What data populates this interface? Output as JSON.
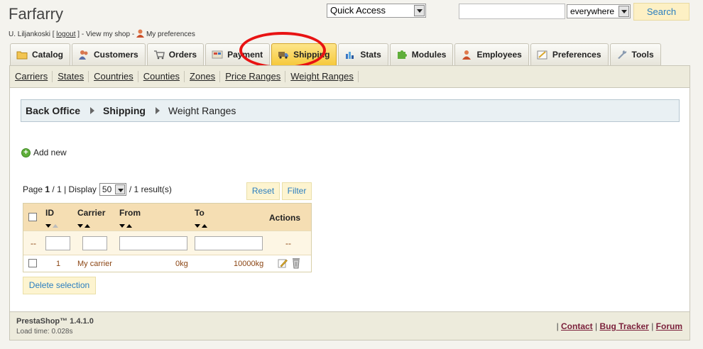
{
  "header": {
    "shop_title": "Farfarry",
    "user_name": "U. Liljankoski",
    "logout_label": "logout",
    "view_shop_label": "View my shop",
    "preferences_label": "My preferences",
    "quick_access_label": "Quick Access",
    "search_value": "",
    "search_scope": "everywhere",
    "search_button": "Search"
  },
  "tabs": [
    {
      "label": "Catalog",
      "icon": "folder-icon",
      "active": false
    },
    {
      "label": "Customers",
      "icon": "customers-icon",
      "active": false
    },
    {
      "label": "Orders",
      "icon": "cart-icon",
      "active": false
    },
    {
      "label": "Payment",
      "icon": "payment-icon",
      "active": false
    },
    {
      "label": "Shipping",
      "icon": "truck-icon",
      "active": true
    },
    {
      "label": "Stats",
      "icon": "chart-icon",
      "active": false
    },
    {
      "label": "Modules",
      "icon": "puzzle-icon",
      "active": false
    },
    {
      "label": "Employees",
      "icon": "employee-icon",
      "active": false
    },
    {
      "label": "Preferences",
      "icon": "preferences-icon",
      "active": false
    },
    {
      "label": "Tools",
      "icon": "wrench-icon",
      "active": false
    }
  ],
  "subnav": [
    "Carriers",
    "States",
    "Countries",
    "Counties",
    "Zones",
    "Price Ranges",
    "Weight Ranges"
  ],
  "breadcrumb": {
    "root": "Back Office",
    "section": "Shipping",
    "current": "Weight Ranges"
  },
  "add_new_label": "Add new",
  "pager": {
    "page_label": "Page",
    "page_current": "1",
    "page_total_text": "/ 1 | Display",
    "display_value": "50",
    "results_text": "/ 1 result(s)"
  },
  "buttons": {
    "reset": "Reset",
    "filter": "Filter",
    "delete_selection": "Delete selection"
  },
  "table": {
    "columns": [
      "ID",
      "Carrier",
      "From",
      "To",
      "Actions"
    ],
    "filter_placeholder": "--",
    "filter_actions": "--",
    "rows": [
      {
        "id": "1",
        "carrier": "My carrier",
        "from": "0kg",
        "to": "10000kg"
      }
    ]
  },
  "footer": {
    "version": "PrestaShop™ 1.4.1.0",
    "load_time": "Load time: 0.028s",
    "links": [
      "Contact",
      "Bug Tracker",
      "Forum"
    ]
  },
  "colors": {
    "active_tab": "#f6c93c",
    "link_blue": "#2a7ec0",
    "highlight_ring": "#e81313"
  }
}
